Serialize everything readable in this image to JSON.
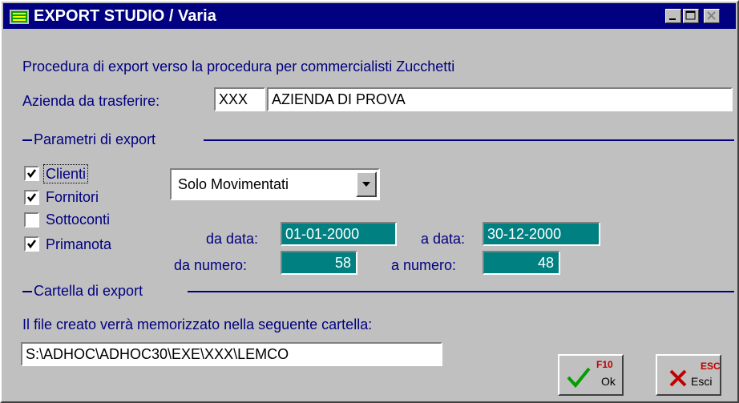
{
  "window": {
    "title": "EXPORT STUDIO / Varia"
  },
  "description": "Procedura di export verso la procedura per commercialisti Zucchetti",
  "azienda": {
    "label": "Azienda da trasferire:",
    "code": "XXX",
    "name": "AZIENDA DI PROVA"
  },
  "sections": {
    "parametri": "Parametri di export",
    "cartella": "Cartella di export"
  },
  "checkboxes": [
    {
      "label": "Clienti",
      "checked": true
    },
    {
      "label": "Fornitori",
      "checked": true
    },
    {
      "label": "Sottoconti",
      "checked": false
    },
    {
      "label": "Primanota",
      "checked": true
    }
  ],
  "filter": {
    "selected": "Solo Movimentati"
  },
  "range": {
    "da_data_label": "da data:",
    "da_data": "01-01-2000",
    "a_data_label": "a data:",
    "a_data": "30-12-2000",
    "da_numero_label": "da numero:",
    "da_numero": "58",
    "a_numero_label": "a numero:",
    "a_numero": "48"
  },
  "folder": {
    "info": "Il file creato verrà memorizzato nella seguente cartella:",
    "path": "S:\\ADHOC\\ADHOC30\\EXE\\XXX\\LEMCO"
  },
  "buttons": {
    "ok_key": "F10",
    "ok_label": "Ok",
    "esc_key": "ESC",
    "esc_label": "Esci"
  }
}
